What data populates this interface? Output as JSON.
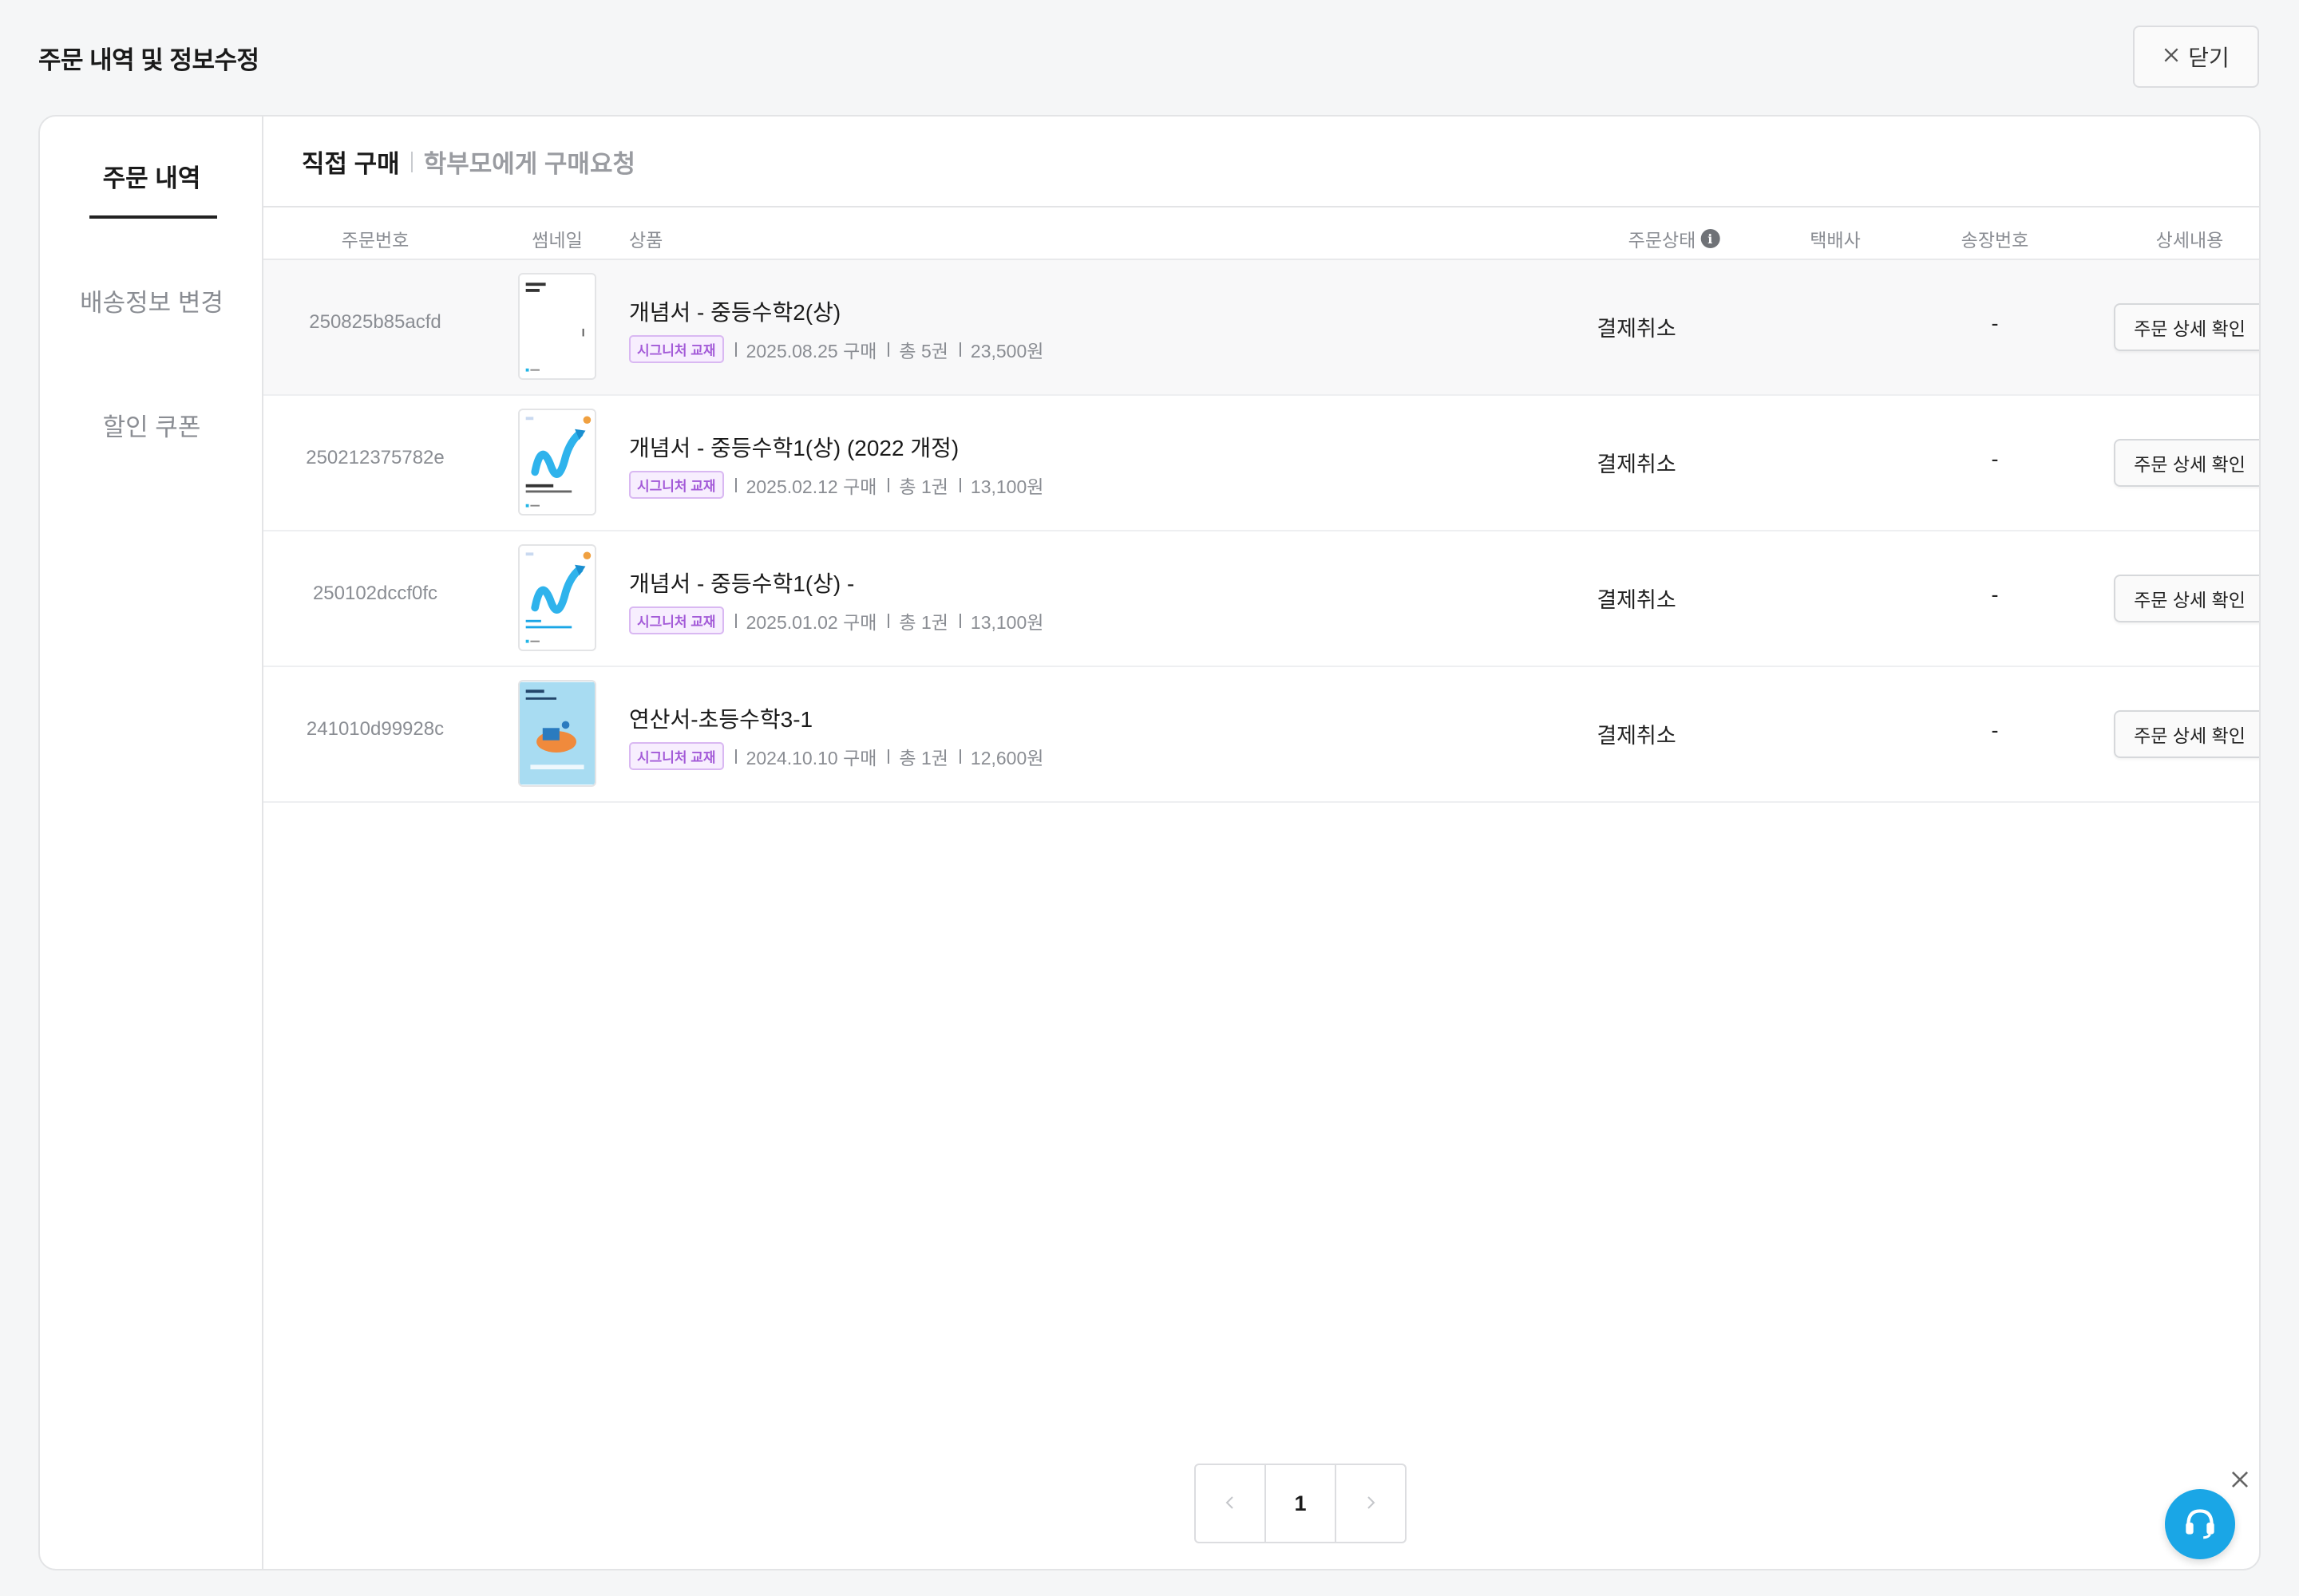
{
  "page": {
    "title": "주문 내역 및 정보수정",
    "close_label": "닫기"
  },
  "sidebar": {
    "items": [
      {
        "label": "주문 내역",
        "active": true
      },
      {
        "label": "배송정보 변경",
        "active": false
      },
      {
        "label": "할인 쿠폰",
        "active": false
      }
    ]
  },
  "purchase_tabs": {
    "direct": "직접 구매",
    "parent": "학부모에게 구매요청"
  },
  "table": {
    "headers": {
      "order_no": "주문번호",
      "thumbnail": "썸네일",
      "product": "상품",
      "status": "주문상태",
      "courier": "택배사",
      "tracking": "송장번호",
      "detail": "상세내용"
    },
    "rows": [
      {
        "order_no": "250825b85acfd",
        "product": "개념서 - 중등수학2(상)",
        "badge": "시그니처 교재",
        "date": "2025.08.25 구매",
        "qty": "총 5권",
        "price": "23,500원",
        "status": "결제취소",
        "tracking": "-",
        "detail_label": "주문 상세 확인",
        "thumb_style": "plain"
      },
      {
        "order_no": "250212375782e",
        "product": "개념서 - 중등수학1(상) (2022 개정)",
        "badge": "시그니처 교재",
        "date": "2025.02.12 구매",
        "qty": "총 1권",
        "price": "13,100원",
        "status": "결제취소",
        "tracking": "-",
        "detail_label": "주문 상세 확인",
        "thumb_style": "arrow"
      },
      {
        "order_no": "250102dccf0fc",
        "product": "개념서 - 중등수학1(상) -",
        "badge": "시그니처 교재",
        "date": "2025.01.02 구매",
        "qty": "총 1권",
        "price": "13,100원",
        "status": "결제취소",
        "tracking": "-",
        "detail_label": "주문 상세 확인",
        "thumb_style": "arrow"
      },
      {
        "order_no": "241010d99928c",
        "product": "연산서-초등수학3-1",
        "badge": "시그니처 교재",
        "date": "2024.10.10 구매",
        "qty": "총 1권",
        "price": "12,600원",
        "status": "결제취소",
        "tracking": "-",
        "detail_label": "주문 상세 확인",
        "thumb_style": "blue"
      }
    ]
  },
  "pagination": {
    "current_page": "1"
  },
  "colors": {
    "badge_text": "#a35ad8",
    "fab": "#1aa6e6"
  },
  "icons": [
    "close-icon",
    "info-icon",
    "chevron-left-icon",
    "chevron-right-icon",
    "headset-icon"
  ]
}
